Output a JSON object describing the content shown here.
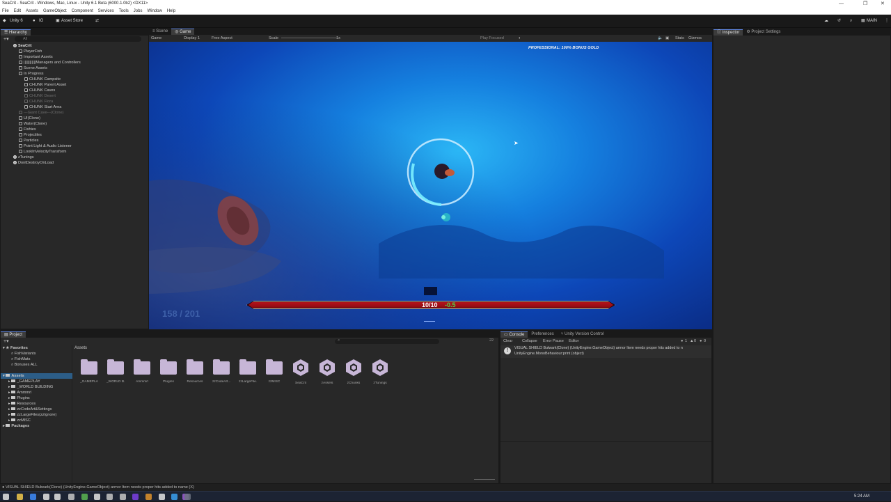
{
  "window": {
    "title": "SeaCrit - SeaCrit - Windows, Mac, Linux - Unity 6.1 Beta (6000.1.0b2) <DX11>",
    "minimize": "—",
    "maximize": "❐",
    "close": "✕"
  },
  "menu": [
    "File",
    "Edit",
    "Assets",
    "GameObject",
    "Component",
    "Services",
    "Tools",
    "Jobs",
    "Window",
    "Help"
  ],
  "toolbar": {
    "unity_label": "Unity 6",
    "account_label": "IG",
    "asset_store_label": "Asset Store",
    "layout_label": "MAIN"
  },
  "hierarchy": {
    "tab_label": "Hierarchy",
    "search_placeholder": "All",
    "rows": [
      {
        "label": "SeaCrit",
        "style": "unity bold"
      },
      {
        "label": "PlayerFish",
        "style": ""
      },
      {
        "label": "Important Assets",
        "style": ""
      },
      {
        "label": "||||||||||||Managers and Controllers",
        "style": ""
      },
      {
        "label": "Scene Assets",
        "style": ""
      },
      {
        "label": "In Progress",
        "style": ""
      },
      {
        "label": "CHUNK Campsite",
        "style": ""
      },
      {
        "label": "CHUNK Parent Asset",
        "style": ""
      },
      {
        "label": "CHUNK Caves",
        "style": ""
      },
      {
        "label": "CHUNK Desert",
        "style": "dim"
      },
      {
        "label": "CHUNK Flora",
        "style": "dim"
      },
      {
        "label": "CHUNK Start Area",
        "style": ""
      },
      {
        "label": "---Giant Cave---(Clone)",
        "style": "dim"
      },
      {
        "label": "UI(Clone)",
        "style": ""
      },
      {
        "label": "Water(Clone)",
        "style": ""
      },
      {
        "label": "Fishies",
        "style": ""
      },
      {
        "label": "Projectiles",
        "style": ""
      },
      {
        "label": "Particles",
        "style": ""
      },
      {
        "label": "Point Light & Audio Listener",
        "style": ""
      },
      {
        "label": "LookInVelocityTransform",
        "style": ""
      },
      {
        "label": "zTunings",
        "style": "unity"
      },
      {
        "label": "DontDestroyOnLoad",
        "style": "unity"
      }
    ]
  },
  "scene_tabs": [
    {
      "label": "Scene",
      "active": false
    },
    {
      "label": "Game",
      "active": true
    }
  ],
  "gamebar": {
    "mode": "Game",
    "display": "Display 1",
    "aspect": "Free Aspect",
    "scale_label": "Scale",
    "scale_value": "1x",
    "play_focused": "Play Focused",
    "stats": "Stats",
    "gizmos": "Gizmos"
  },
  "game": {
    "banner": "PROFESSIONAL: 100% BONUS GOLD",
    "counter": "158 / 201",
    "health": "10/10",
    "regen": "-0.5",
    "health_fraction": 1.0
  },
  "inspector_tabs": [
    {
      "label": "Inspector",
      "active": true
    },
    {
      "label": "Project Settings",
      "active": false
    }
  ],
  "project": {
    "tab_label": "Project",
    "favorites_label": "Favorites",
    "favorites": [
      "FishVariants",
      "FishMats",
      "Bonuses ALL"
    ],
    "assets_label": "Assets",
    "tree": [
      "_GAMEPLAY",
      "_WORLD BUILDING",
      "Ammmrl",
      "Plugins",
      "Resources",
      "zzCodeArt&Settings",
      "zzLargeFiles(zzIgnore)",
      "zzMISC"
    ],
    "packages_label": "Packages",
    "breadcrumb": "Assets",
    "count": "22",
    "items": [
      {
        "label": "_GAMEPLAY",
        "kind": "folder"
      },
      {
        "label": "_WORLD B...",
        "kind": "folder"
      },
      {
        "label": "Ammmrl",
        "kind": "folder"
      },
      {
        "label": "Plugins",
        "kind": "folder"
      },
      {
        "label": "Resources",
        "kind": "folder"
      },
      {
        "label": "zzCodeArt...",
        "kind": "folder"
      },
      {
        "label": "zzLargeFile...",
        "kind": "folder"
      },
      {
        "label": "zzMISC",
        "kind": "folder"
      },
      {
        "label": "SeaCrit",
        "kind": "scene"
      },
      {
        "label": "zAssets",
        "kind": "scene"
      },
      {
        "label": "zChunks",
        "kind": "scene"
      },
      {
        "label": "zTunings",
        "kind": "scene"
      }
    ]
  },
  "console": {
    "tabs": [
      {
        "label": "Console",
        "active": true
      },
      {
        "label": "Preferences",
        "active": false
      },
      {
        "label": "Unity Version Control",
        "active": false
      }
    ],
    "clear": "Clear",
    "collapse": "Collapse",
    "error_pause": "Error Pause",
    "editor": "Editor",
    "counts": [
      "1",
      "0",
      "0"
    ],
    "message_line1": "VISUAL SHIELD Bulwark(Clone) (UnityEngine.GameObject) armor Item needs proper hits added to n",
    "message_line2": "UnityEngine.MonoBehaviour:print (object)"
  },
  "statusbar": "VISUAL SHIELD Bulwark(Clone) (UnityEngine.GameObject) armor Item needs proper hits added to name (X)",
  "taskbar": {
    "time": "5:24 AM",
    "icon_colors": [
      "#e3e3e3",
      "#f2c94c",
      "#3d8bfd",
      "#e3e3e3",
      "#e3e3e3",
      "#c5c5c5",
      "#5ab552",
      "#e3e3e3",
      "#c5c5c5",
      "#c5c5c5",
      "#7b3fe4",
      "#e0932b",
      "#e3e3e3",
      "#3aa0f0",
      "#9c5cd6",
      "#6b7280"
    ]
  },
  "colors": {
    "accent": "#5d6cc9",
    "health_bar": "#b5121b",
    "regen_green": "#4dd64a",
    "water_deep": "#0a2a7a",
    "water_light": "#1f88e0"
  }
}
